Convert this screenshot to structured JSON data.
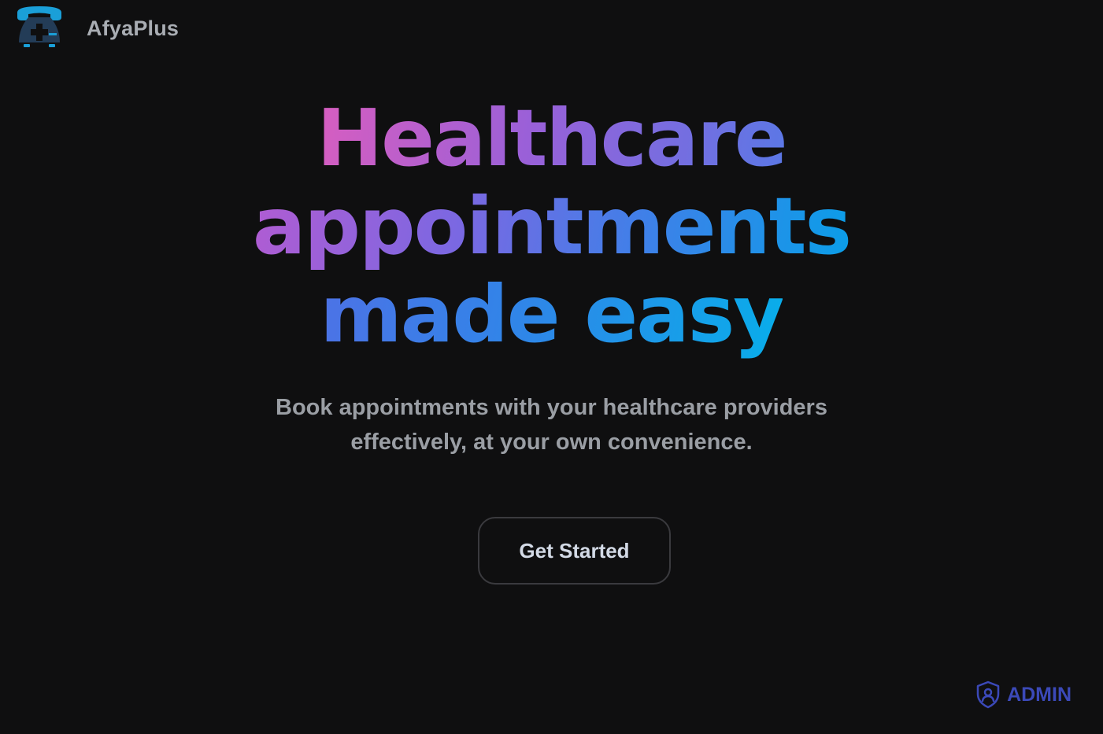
{
  "header": {
    "brand": "AfyaPlus",
    "logo_icon": "phone-medical-icon"
  },
  "hero": {
    "title_lines": [
      "Healthcare",
      "appointments",
      "made easy"
    ],
    "subtitle": "Book appointments with your healthcare providers effectively, at your own convenience.",
    "gradient_colors": [
      "#d85ec0",
      "#8a63e0",
      "#3b7fe8",
      "#08aeea"
    ]
  },
  "cta": {
    "label": "Get Started"
  },
  "admin": {
    "label": "ADMIN",
    "icon": "shield-user-icon",
    "color": "#3b49b8"
  },
  "colors": {
    "background": "#0f0f10",
    "brand_text": "#a9adb3",
    "subtitle_text": "#9a9ea4"
  }
}
